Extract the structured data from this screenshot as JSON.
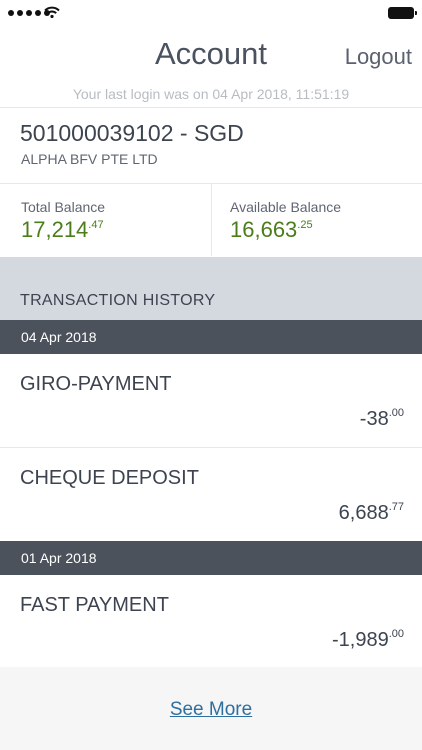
{
  "header": {
    "title": "Account",
    "logout_label": "Logout",
    "last_login": "Your last login was on 04 Apr 2018, 11:51:19"
  },
  "account": {
    "number_currency": "501000039102 - SGD",
    "holder": "ALPHA BFV PTE LTD"
  },
  "balances": {
    "total_label": "Total Balance",
    "total_main": "17,214",
    "total_cents": ".47",
    "available_label": "Available Balance",
    "available_main": "16,663",
    "available_cents": ".25",
    "value_color": "#4b7d1b"
  },
  "history": {
    "title": "TRANSACTION HISTORY",
    "groups": [
      {
        "date": "04 Apr 2018",
        "transactions": [
          {
            "name": "GIRO-PAYMENT",
            "amount_main": "-38",
            "amount_cents": ".00"
          },
          {
            "name": "CHEQUE DEPOSIT",
            "amount_main": "6,688",
            "amount_cents": ".77"
          }
        ]
      },
      {
        "date": "01 Apr 2018",
        "transactions": [
          {
            "name": "FAST PAYMENT",
            "amount_main": "-1,989",
            "amount_cents": ".00"
          }
        ]
      }
    ]
  },
  "footer": {
    "see_more_label": "See More",
    "link_color": "#2e6f9e"
  },
  "icons": [
    "signal-dots-icon",
    "wifi-icon",
    "battery-icon"
  ]
}
